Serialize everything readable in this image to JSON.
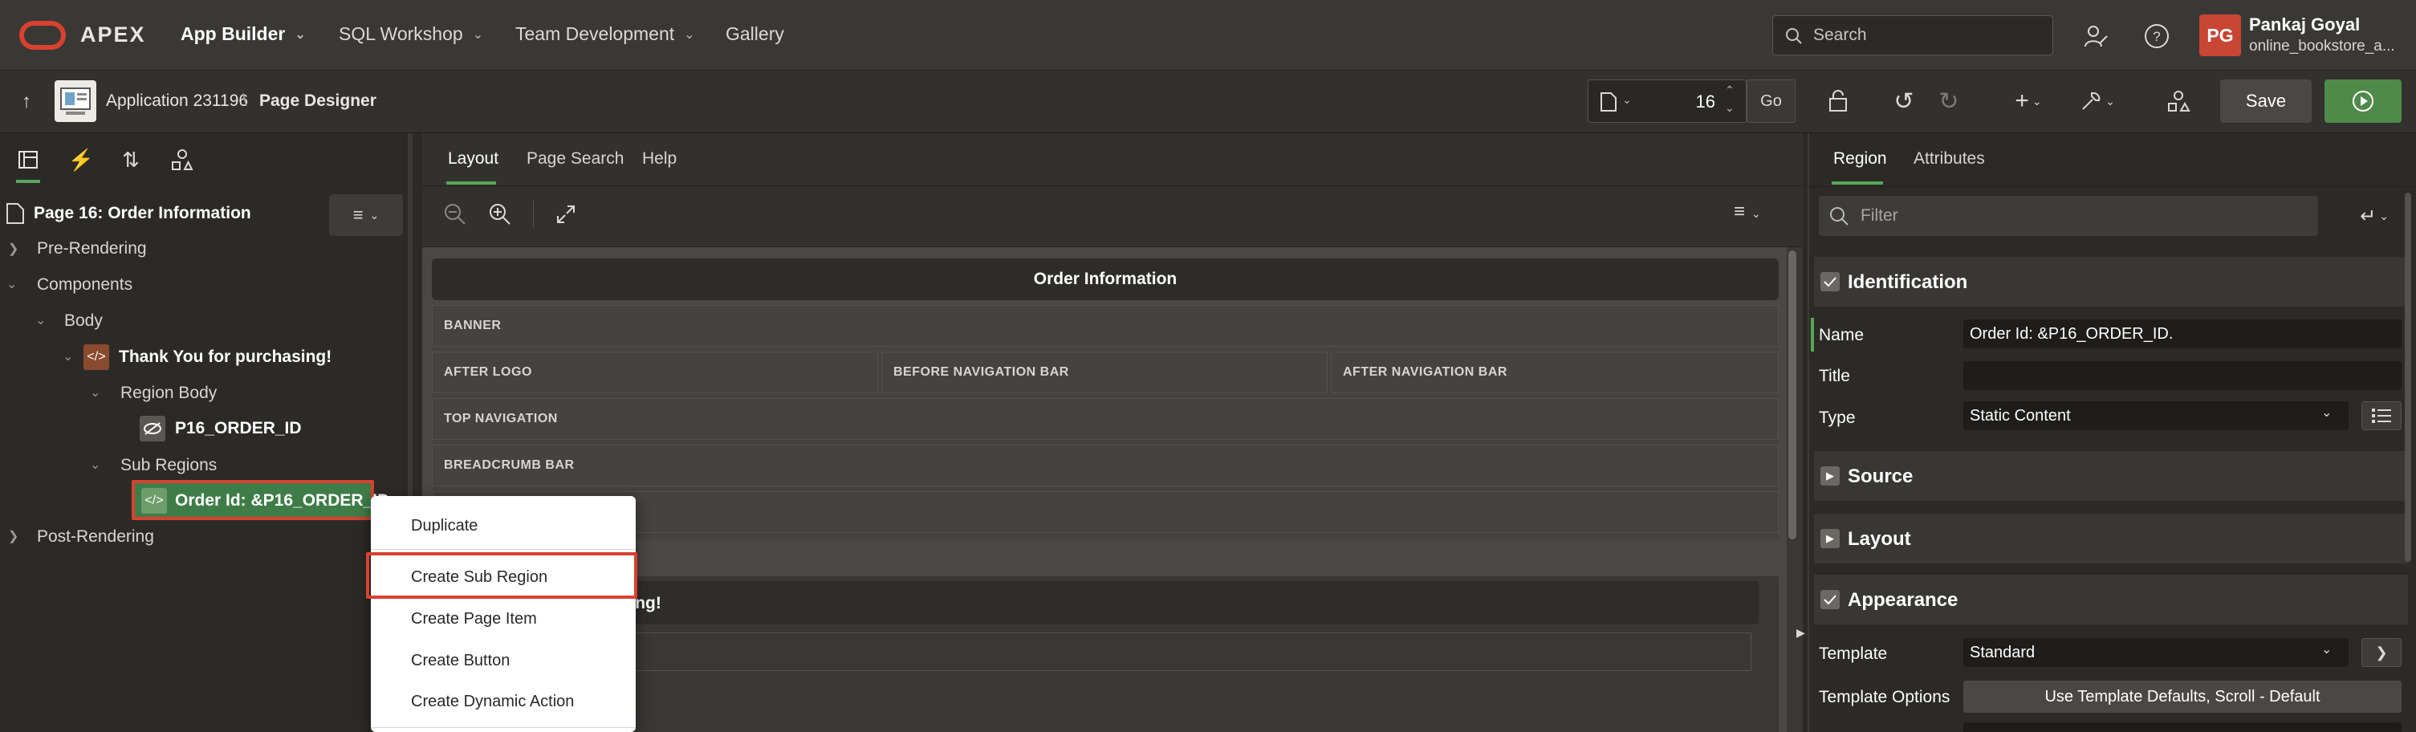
{
  "topbar": {
    "brand": "APEX",
    "nav": [
      {
        "label": "App Builder",
        "active": true
      },
      {
        "label": "SQL Workshop"
      },
      {
        "label": "Team Development"
      },
      {
        "label": "Gallery"
      }
    ],
    "search_placeholder": "Search",
    "user_initials": "PG",
    "user_name": "Pankaj Goyal",
    "user_app": "online_bookstore_a..."
  },
  "toolbar": {
    "app_label": "Application 231196",
    "separator": "\\",
    "page_designer": "Page Designer",
    "page_number": "16",
    "go_label": "Go",
    "save_label": "Save"
  },
  "left": {
    "page_title": "Page 16: Order Information",
    "tree": {
      "pre_rendering": "Pre-Rendering",
      "components": "Components",
      "body": "Body",
      "thank_you": "Thank You for purchasing!",
      "region_body": "Region Body",
      "p16_order_id": "P16_ORDER_ID",
      "sub_regions": "Sub Regions",
      "order_id_region": "Order Id: &P16_ORDER_ID.",
      "post_rendering": "Post-Rendering"
    }
  },
  "center": {
    "tabs": [
      "Layout",
      "Page Search",
      "Help"
    ],
    "region_header": "Order Information",
    "slots": {
      "banner": "BANNER",
      "after_logo": "AFTER LOGO",
      "before_nav": "BEFORE NAVIGATION BAR",
      "after_nav": "AFTER NAVIGATION BAR",
      "top_nav": "TOP NAVIGATION",
      "breadcrumb": "BREADCRUMB BAR"
    },
    "thank_fragment": "asing!"
  },
  "context_menu": {
    "items": [
      "Duplicate",
      "Create Sub Region",
      "Create Page Item",
      "Create Button",
      "Create Dynamic Action"
    ],
    "highlighted": "Create Sub Region"
  },
  "right": {
    "tabs": [
      "Region",
      "Attributes"
    ],
    "filter_placeholder": "Filter",
    "sections": {
      "identification": "Identification",
      "source": "Source",
      "layout": "Layout",
      "appearance": "Appearance"
    },
    "props": {
      "name_label": "Name",
      "name_value": "Order Id: &P16_ORDER_ID.",
      "title_label": "Title",
      "title_value": "",
      "type_label": "Type",
      "type_value": "Static Content",
      "template_label": "Template",
      "template_value": "Standard",
      "template_options_label": "Template Options",
      "template_options_value": "Use Template Defaults, Scroll - Default"
    }
  },
  "colors": {
    "accent_red": "#d9412e",
    "accent_green": "#5aa65a",
    "selected_green": "#3f7d48"
  }
}
